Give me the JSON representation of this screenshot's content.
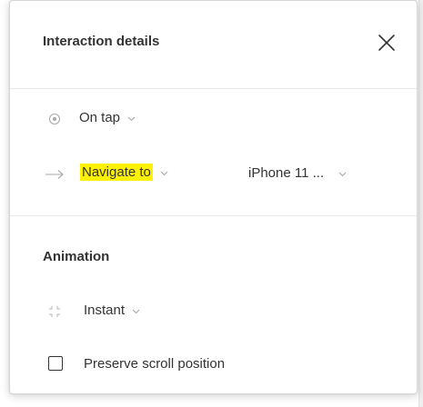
{
  "dialog": {
    "title": "Interaction details",
    "close_icon": "close-icon"
  },
  "trigger": {
    "icon": "tap-circle-icon",
    "value": "On tap"
  },
  "action": {
    "icon": "arrow-right-icon",
    "value": "Navigate to",
    "highlight_color": "#fff200",
    "destination": "iPhone 11 ..."
  },
  "animation": {
    "title": "Animation",
    "icon": "instant-corners-icon",
    "value": "Instant",
    "preserve_scroll_label": "Preserve scroll position",
    "preserve_scroll_checked": false
  }
}
